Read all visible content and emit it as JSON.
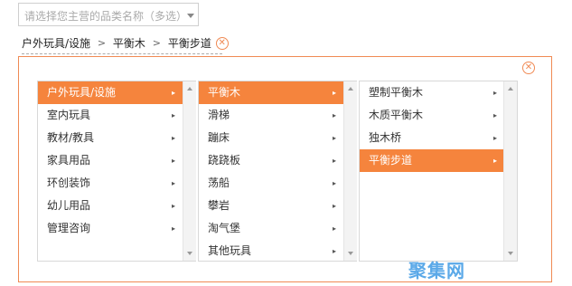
{
  "select": {
    "placeholder": "请选择您主营的品类名称（多选）"
  },
  "breadcrumb": {
    "items": [
      "户外玩具/设施",
      "平衡木",
      "平衡步道"
    ],
    "separator": ">",
    "remove": "✕"
  },
  "panel": {
    "close": "✕"
  },
  "columns": [
    {
      "items": [
        "户外玩具/设施",
        "室内玩具",
        "教材/教具",
        "家具用品",
        "环创装饰",
        "幼儿用品",
        "管理咨询"
      ],
      "active": 0
    },
    {
      "items": [
        "平衡木",
        "滑梯",
        "蹦床",
        "跷跷板",
        "荡船",
        "攀岩",
        "淘气堡",
        "其他玩具"
      ],
      "active": 0
    },
    {
      "items": [
        "塑制平衡木",
        "木质平衡木",
        "独木桥",
        "平衡步道"
      ],
      "active": 3
    }
  ],
  "arrow": "▸",
  "watermark": "聚集网"
}
